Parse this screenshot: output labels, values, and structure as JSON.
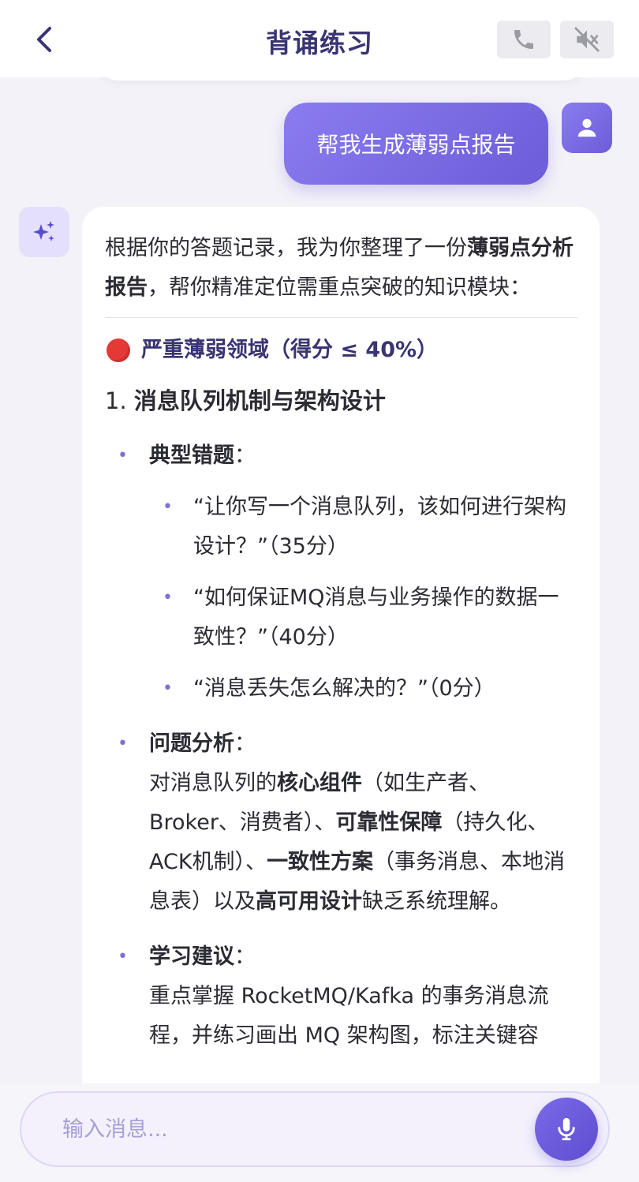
{
  "header": {
    "title": "背诵练习",
    "back_icon": "chevron-left-icon",
    "phone_icon": "phone-icon",
    "mute_icon": "volume-mute-icon"
  },
  "user_message": {
    "text": "帮我生成薄弱点报告",
    "avatar_icon": "user-icon"
  },
  "ai_message": {
    "avatar_icon": "sparkle-icon",
    "intro_before": "根据你的答题记录，我为你整理了一份",
    "intro_bold": "薄弱点分析报告",
    "intro_after": "，帮你精准定位需重点突破的知识模块：",
    "section_heading": "严重薄弱领域（得分 ≤ 40%）",
    "topic_number": "1.",
    "topic_title": "消息队列机制与架构设计",
    "typical_errors_label": "典型错题",
    "typical_errors": [
      "“让你写一个消息队列，该如何进行架构设计？”（35分）",
      "“如何保证MQ消息与业务操作的数据一致性？”（40分）",
      "“消息丢失怎么解决的？”（0分）"
    ],
    "analysis_label": "问题分析",
    "analysis": {
      "t1": "对消息队列的",
      "b1": "核心组件",
      "t2": "（如生产者、Broker、消费者）、",
      "b2": "可靠性保障",
      "t3": "（持久化、ACK机制）、",
      "b3": "一致性方案",
      "t4": "（事务消息、本地消息表）以及",
      "b4": "高可用设计",
      "t5": "缺乏系统理解。"
    },
    "suggestion_label": "学习建议",
    "suggestion_text": "重点掌握 RocketMQ/Kafka 的事务消息流程，并练习画出 MQ 架构图，标注关键容"
  },
  "input": {
    "placeholder": "输入消息...",
    "mic_icon": "microphone-icon"
  },
  "colors": {
    "accent": "#6c5dd8",
    "title": "#3a3472",
    "alert_dot": "#e53935"
  }
}
